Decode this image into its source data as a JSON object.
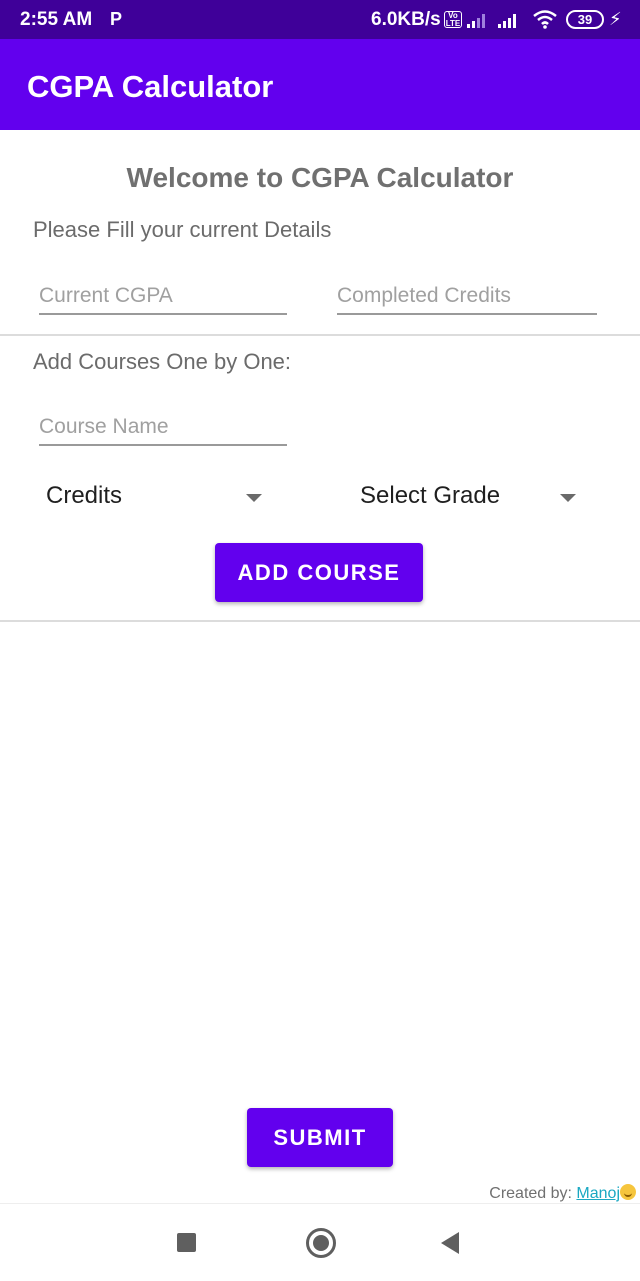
{
  "status_bar": {
    "time": "2:55 AM",
    "p_icon_text": "P",
    "network_speed": "6.0KB/s",
    "volte_text": "Vo LTE",
    "battery_level": "39",
    "icons": [
      "signal-icon",
      "signal-icon",
      "wifi-icon",
      "battery-icon",
      "charging-bolt-icon"
    ]
  },
  "app_bar": {
    "title": "CGPA Calculator",
    "color": "#6200ee"
  },
  "welcome_title": "Welcome to CGPA Calculator",
  "details_prompt": "Please Fill your current Details",
  "inputs": {
    "current_cgpa": {
      "value": "",
      "placeholder": "Current CGPA"
    },
    "completed_credits": {
      "value": "",
      "placeholder": "Completed Credits"
    },
    "course_name": {
      "value": "",
      "placeholder": "Course Name"
    }
  },
  "courses_prompt": "Add Courses One by One:",
  "spinners": {
    "credits": {
      "selected": "Credits"
    },
    "grade": {
      "selected": "Select Grade"
    }
  },
  "buttons": {
    "add_course": "ADD COURSE",
    "submit": "SUBMIT"
  },
  "footer": {
    "created_by": "Created by: ",
    "author": "Manoj"
  },
  "nav_bar": {
    "icons": [
      "recent-apps-icon",
      "home-icon",
      "back-icon"
    ]
  }
}
